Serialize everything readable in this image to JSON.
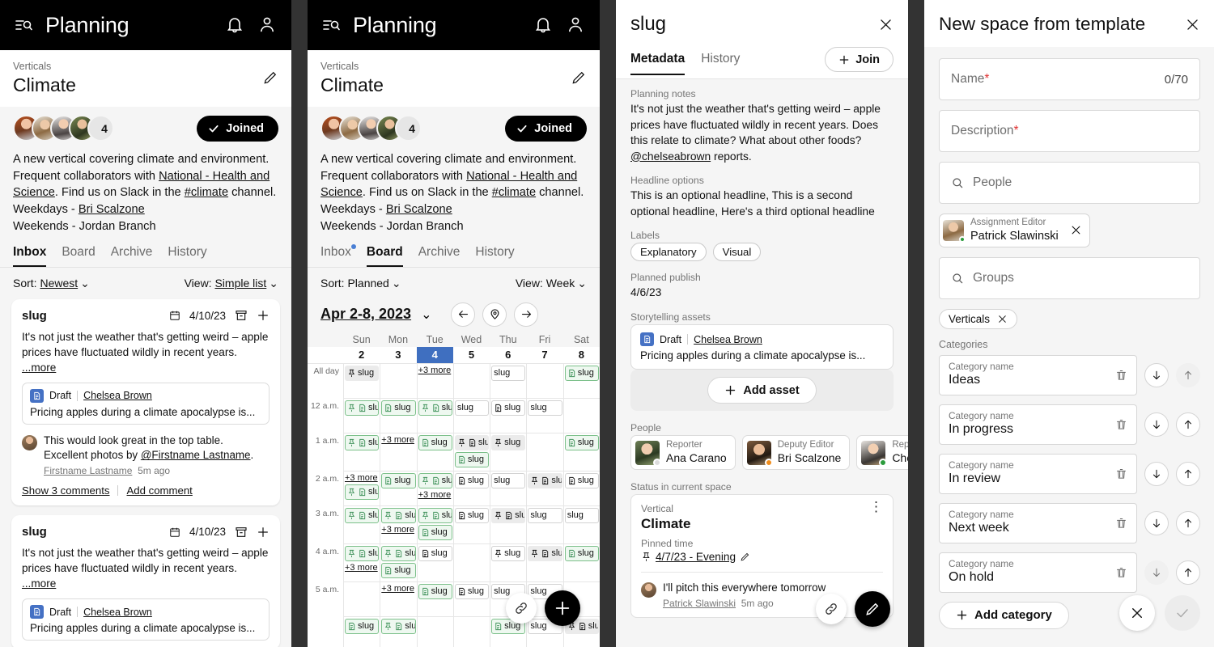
{
  "app": {
    "title": "Planning",
    "menu_icon": "list-search-icon",
    "bell_icon": "bell-icon",
    "account_icon": "account-icon"
  },
  "vertical": {
    "eyebrow": "Verticals",
    "name": "Climate",
    "member_count": "4",
    "joined_label": "Joined",
    "description_parts": {
      "p1": "A new vertical covering climate and environment. Frequent collaborators with ",
      "link1": "National - Health and Science",
      "p2": ". Find us on Slack in the ",
      "link2": "#climate",
      "p3": " channel.",
      "weekdays_prefix": "Weekdays - ",
      "weekdays_person": "Bri Scalzone",
      "weekends": "Weekends - Jordan Branch"
    }
  },
  "tabs": [
    {
      "label": "Inbox",
      "active_p1": true,
      "active_p2": false,
      "badge": true
    },
    {
      "label": "Board",
      "active_p1": false,
      "active_p2": true,
      "badge": false
    },
    {
      "label": "Archive",
      "active_p1": false,
      "active_p2": false,
      "badge": false
    },
    {
      "label": "History",
      "active_p1": false,
      "active_p2": false,
      "badge": false
    }
  ],
  "panel1": {
    "sort_label": "Sort:",
    "sort_value": "Newest",
    "view_label": "View:",
    "view_value": "Simple list",
    "cards": [
      {
        "slug": "slug",
        "date": "4/10/23",
        "text": "It's not just the weather that's getting weird – apple prices have fluctuated wildly in recent years.",
        "more": "...more",
        "asset": {
          "type": "Draft",
          "author": "Chelsea Brown",
          "text": "Pricing apples during a climate apocalypse is..."
        },
        "comment": {
          "text_a": "This would look great in the top table. Excellent photos by ",
          "mention": "@Firstname Lastname",
          "text_b": ".",
          "author": "Firstname Lastname",
          "time": "5m ago"
        },
        "show_comments": "Show 3 comments",
        "add_comment": "Add comment"
      },
      {
        "slug": "slug",
        "date": "4/10/23",
        "text": "It's not just the weather that's getting weird – apple prices have fluctuated wildly in recent years.",
        "more": "...more",
        "asset": {
          "type": "Draft",
          "author": "Chelsea Brown",
          "text": "Pricing apples during a climate apocalypse is..."
        }
      }
    ]
  },
  "panel2": {
    "sort_label": "Sort:",
    "sort_value": "Planned",
    "view_label": "View:",
    "view_value": "Week",
    "date_range": "Apr 2-8, 2023",
    "nav": {
      "prev": "arrow-left-icon",
      "today": "location-pin-icon",
      "next": "arrow-right-icon"
    },
    "day_names": [
      "Sun",
      "Mon",
      "Tue",
      "Wed",
      "Thu",
      "Fri",
      "Sat"
    ],
    "day_numbers": [
      "2",
      "3",
      "4",
      "5",
      "6",
      "7",
      "8"
    ],
    "today_index": 2,
    "event_label": "slug",
    "more_label": "+3 more",
    "time_rows": [
      "All day",
      "12 a.m.",
      "1 a.m.",
      "2 a.m.",
      "3 a.m.",
      "4 a.m.",
      "5 a.m.",
      ""
    ],
    "grid": [
      [
        [
          {
            "k": "gray",
            "p": 1,
            "d": 0
          }
        ],
        [],
        [
          {
            "k": "more"
          }
        ],
        [],
        [
          {
            "k": "plain",
            "p": 0,
            "d": 0,
            "w": 2
          }
        ],
        [],
        [
          {
            "k": "green",
            "p": 0,
            "d": 1
          }
        ]
      ],
      [
        [
          {
            "k": "green",
            "p": 1,
            "d": 1
          }
        ],
        [
          {
            "k": "green",
            "p": 0,
            "d": 1
          }
        ],
        [
          {
            "k": "green",
            "p": 1,
            "d": 1
          }
        ],
        [
          {
            "k": "plain",
            "p": 0,
            "d": 0
          }
        ],
        [
          {
            "k": "plain",
            "p": 0,
            "d": 1
          }
        ],
        [
          {
            "k": "plain",
            "p": 0,
            "d": 0
          }
        ],
        []
      ],
      [
        [
          {
            "k": "green",
            "p": 1,
            "d": 1
          }
        ],
        [
          {
            "k": "more"
          }
        ],
        [
          {
            "k": "green",
            "p": 0,
            "d": 1
          }
        ],
        [
          {
            "k": "gray",
            "p": 1,
            "d": 1
          },
          {
            "k": "green",
            "p": 0,
            "d": 1
          }
        ],
        [
          {
            "k": "gray",
            "p": 1,
            "d": 0
          }
        ],
        [],
        [
          {
            "k": "green",
            "p": 0,
            "d": 1
          }
        ]
      ],
      [
        [
          {
            "k": "more"
          },
          {
            "k": "green",
            "p": 1,
            "d": 1
          }
        ],
        [
          {
            "k": "green",
            "p": 0,
            "d": 1
          }
        ],
        [
          {
            "k": "green",
            "p": 1,
            "d": 1
          },
          {
            "k": "more"
          }
        ],
        [
          {
            "k": "plain",
            "p": 0,
            "d": 1
          }
        ],
        [
          {
            "k": "plain",
            "p": 0,
            "d": 0
          }
        ],
        [
          {
            "k": "gray",
            "p": 1,
            "d": 1
          }
        ],
        [
          {
            "k": "plain",
            "p": 0,
            "d": 1
          }
        ]
      ],
      [
        [
          {
            "k": "green",
            "p": 1,
            "d": 1
          }
        ],
        [
          {
            "k": "green",
            "p": 1,
            "d": 1
          },
          {
            "k": "more"
          }
        ],
        [
          {
            "k": "green",
            "p": 1,
            "d": 1
          },
          {
            "k": "green",
            "p": 0,
            "d": 1
          }
        ],
        [
          {
            "k": "plain",
            "p": 0,
            "d": 1
          }
        ],
        [
          {
            "k": "gray",
            "p": 1,
            "d": 1
          }
        ],
        [
          {
            "k": "plain",
            "p": 0,
            "d": 0
          }
        ],
        [
          {
            "k": "plain",
            "p": 0,
            "d": 0
          }
        ]
      ],
      [
        [
          {
            "k": "green",
            "p": 1,
            "d": 1
          },
          {
            "k": "more"
          }
        ],
        [
          {
            "k": "green",
            "p": 1,
            "d": 1
          },
          {
            "k": "green",
            "p": 0,
            "d": 1
          }
        ],
        [
          {
            "k": "plain",
            "p": 0,
            "d": 1
          }
        ],
        [],
        [
          {
            "k": "plain",
            "p": 1,
            "d": 0
          }
        ],
        [
          {
            "k": "gray",
            "p": 1,
            "d": 1
          }
        ],
        [
          {
            "k": "green",
            "p": 0,
            "d": 1
          }
        ]
      ],
      [
        [],
        [
          {
            "k": "more"
          }
        ],
        [
          {
            "k": "green",
            "p": 0,
            "d": 1
          }
        ],
        [
          {
            "k": "plain",
            "p": 0,
            "d": 1
          }
        ],
        [
          {
            "k": "plain",
            "p": 0,
            "d": 0
          }
        ],
        [
          {
            "k": "plain",
            "p": 0,
            "d": 0
          }
        ],
        []
      ],
      [
        [
          {
            "k": "green",
            "p": 0,
            "d": 1
          }
        ],
        [
          {
            "k": "green",
            "p": 1,
            "d": 1
          }
        ],
        [],
        [],
        [
          {
            "k": "green",
            "p": 0,
            "d": 1
          }
        ],
        [
          {
            "k": "plain",
            "p": 0,
            "d": 0
          }
        ],
        [
          {
            "k": "gray",
            "p": 1,
            "d": 1
          }
        ]
      ]
    ],
    "fab_link": "link-icon",
    "fab_add": "plus-icon"
  },
  "panel3": {
    "title": "slug",
    "close": "close-icon",
    "tabs": [
      {
        "label": "Metadata",
        "active": true
      },
      {
        "label": "History",
        "active": false
      }
    ],
    "join_label": "Join",
    "planning_notes_label": "Planning notes",
    "planning_notes_a": "It's not just the weather that's getting weird – apple prices have fluctuated wildly in recent years. Does this relate to climate? What about other foods? ",
    "planning_notes_mention": "@chelseabrown",
    "planning_notes_b": " reports.",
    "headline_label": "Headline options",
    "headline_value": "This is an optional headline, This is a second optional headline, Here's a third optional headline",
    "labels_label": "Labels",
    "labels": [
      "Explanatory",
      "Visual"
    ],
    "publish_label": "Planned publish",
    "publish_value": "4/6/23",
    "assets_label": "Storytelling assets",
    "asset": {
      "type": "Draft",
      "author": "Chelsea Brown",
      "text": "Pricing apples during a climate apocalypse is..."
    },
    "add_asset_label": "Add asset",
    "people_label": "People",
    "people": [
      {
        "role": "Reporter",
        "name": "Ana Carano",
        "status": "#dcdcdc"
      },
      {
        "role": "Deputy Editor",
        "name": "Bri Scalzone",
        "status": "#f08c1a"
      },
      {
        "role": "Reporter",
        "name": "Chelsea",
        "status": "#2c9c3d"
      }
    ],
    "status_label": "Status in current space",
    "status_kind": "Vertical",
    "status_value": "Climate",
    "pinned_label": "Pinned time",
    "pinned_value": "4/7/23 - Evening",
    "comment": {
      "text": "I'll pitch this everywhere tomorrow",
      "author": "Patrick Slawinski",
      "time": "5m ago"
    },
    "fab_link": "link-icon",
    "fab_edit": "pencil-icon"
  },
  "panel4": {
    "title": "New space from template",
    "close": "close-icon",
    "name_placeholder": "Name",
    "name_counter": "0/70",
    "description_placeholder": "Description",
    "people_placeholder": "People",
    "person_chip": {
      "role": "Assignment Editor",
      "name": "Patrick Slawinski",
      "status": "#2c9c3d"
    },
    "groups_placeholder": "Groups",
    "group_chip": "Verticals",
    "categories_label": "Categories",
    "category_field_label": "Category name",
    "categories": [
      {
        "value": "Ideas",
        "down_enabled": true,
        "up_enabled": false
      },
      {
        "value": "In progress",
        "down_enabled": true,
        "up_enabled": true
      },
      {
        "value": "In review",
        "down_enabled": true,
        "up_enabled": true
      },
      {
        "value": "Next week",
        "down_enabled": true,
        "up_enabled": true
      },
      {
        "value": "On hold",
        "down_enabled": false,
        "up_enabled": true
      }
    ],
    "add_category_label": "Add category",
    "cancel": "close-icon",
    "confirm": "check-icon"
  },
  "colors": {
    "accent_blue": "#3f6fc0",
    "green": "#7cc08a",
    "red": "#e03131",
    "badge": "#4a7fd4"
  }
}
